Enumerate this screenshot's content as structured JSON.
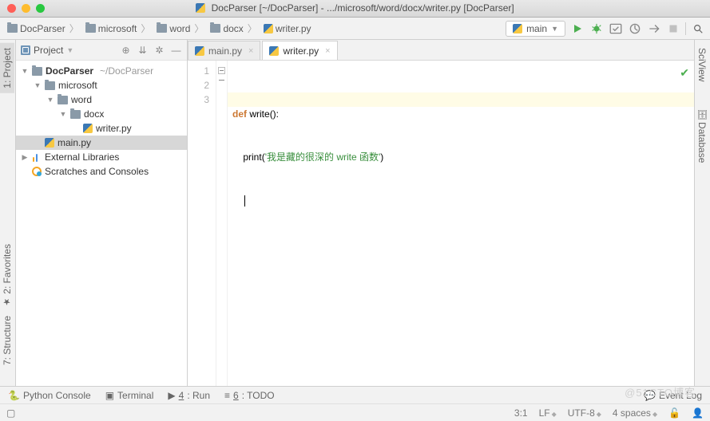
{
  "title": "DocParser [~/DocParser] - .../microsoft/word/docx/writer.py [DocParser]",
  "breadcrumbs": [
    {
      "label": "DocParser"
    },
    {
      "label": "microsoft"
    },
    {
      "label": "word"
    },
    {
      "label": "docx"
    },
    {
      "label": "writer.py",
      "type": "py"
    }
  ],
  "run_config": "main",
  "project_panel": {
    "title": "Project",
    "tree": [
      {
        "indent": 0,
        "arrow": "▼",
        "icon": "folder",
        "label": "DocParser",
        "suffix": "~/DocParser",
        "bold": true
      },
      {
        "indent": 1,
        "arrow": "▼",
        "icon": "folder",
        "label": "microsoft"
      },
      {
        "indent": 2,
        "arrow": "▼",
        "icon": "folder",
        "label": "word"
      },
      {
        "indent": 3,
        "arrow": "▼",
        "icon": "folder",
        "label": "docx"
      },
      {
        "indent": 4,
        "arrow": "",
        "icon": "py",
        "label": "writer.py"
      },
      {
        "indent": 1,
        "arrow": "",
        "icon": "py",
        "label": "main.py",
        "selected": true
      },
      {
        "indent": 0,
        "arrow": "▶",
        "icon": "lib",
        "label": "External Libraries"
      },
      {
        "indent": 0,
        "arrow": "",
        "icon": "scratch",
        "label": "Scratches and Consoles"
      }
    ]
  },
  "left_tabs": [
    "1: Project",
    "2: Favorites",
    "7: Structure"
  ],
  "right_tabs": [
    "SciView",
    "Database"
  ],
  "editor_tabs": [
    {
      "label": "main.py",
      "active": false
    },
    {
      "label": "writer.py",
      "active": true
    }
  ],
  "code": {
    "lines": [
      "1",
      "2",
      "3"
    ],
    "l1_kw": "def ",
    "l1_fn": "write",
    "l1_rest": "():",
    "l2_fn": "print",
    "l2_p1": "(",
    "l2_str": "'我是藏的很深的 write 函数'",
    "l2_p2": ")"
  },
  "footer": {
    "python_console": "Python Console",
    "terminal": "Terminal",
    "run": "4: Run",
    "run_u": "4",
    "todo": "6: TODO",
    "todo_u": "6",
    "event_log": "Event Log"
  },
  "status": {
    "pos": "3:1",
    "line_sep": "LF",
    "encoding": "UTF-8",
    "indent": "4 spaces"
  },
  "watermark": "@51CTO博客"
}
